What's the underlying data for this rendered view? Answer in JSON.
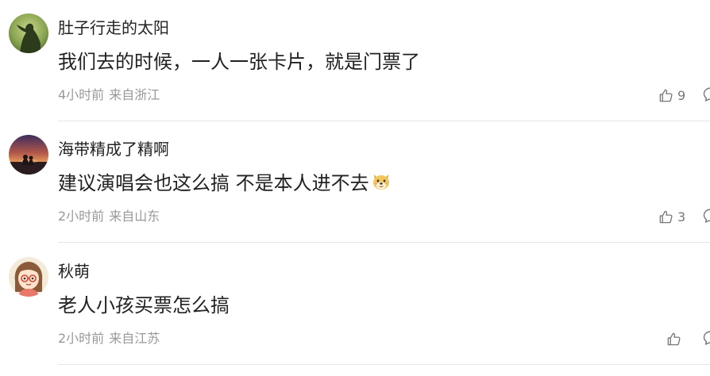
{
  "comments": [
    {
      "username": "肚子行走的太阳",
      "text": "我们去的时候，一人一张卡片，就是门票了",
      "time": "4小时前",
      "location": "来自浙江",
      "likes": "9",
      "avatar_icon": "green-silhouette-avatar"
    },
    {
      "username": "海带精成了精啊",
      "text": "建议演唱会也这么搞 不是本人进不去",
      "emoji": "dog-face-emoji",
      "time": "2小时前",
      "location": "来自山东",
      "likes": "3",
      "avatar_icon": "sunset-avatar"
    },
    {
      "username": "秋萌",
      "text": "老人小孩买票怎么搞",
      "time": "2小时前",
      "location": "来自江苏",
      "likes": "",
      "avatar_icon": "cartoon-girl-avatar"
    }
  ],
  "icons": {
    "like": "thumbs-up-icon",
    "reply": "reply-bubble-icon"
  },
  "colors": {
    "text": "#222222",
    "meta": "#999999",
    "icon": "#777777",
    "divider": "#e6e6e6"
  }
}
